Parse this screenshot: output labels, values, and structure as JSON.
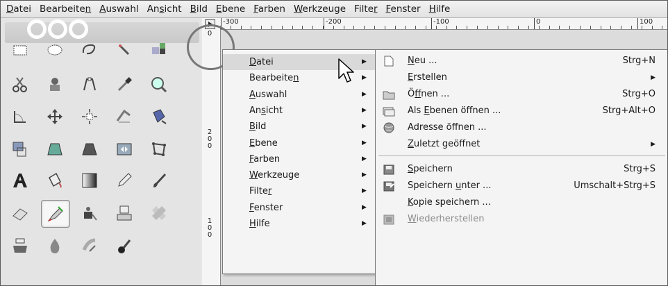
{
  "menubar": {
    "items": [
      {
        "pre": "",
        "key": "D",
        "post": "atei"
      },
      {
        "pre": "Bearbeite",
        "key": "n",
        "post": ""
      },
      {
        "pre": "",
        "key": "A",
        "post": "uswahl"
      },
      {
        "pre": "An",
        "key": "s",
        "post": "icht"
      },
      {
        "pre": "",
        "key": "B",
        "post": "ild"
      },
      {
        "pre": "",
        "key": "E",
        "post": "bene"
      },
      {
        "pre": "",
        "key": "F",
        "post": "arben"
      },
      {
        "pre": "",
        "key": "W",
        "post": "erkzeuge"
      },
      {
        "pre": "Filte",
        "key": "r",
        "post": ""
      },
      {
        "pre": "",
        "key": "F",
        "post": "enster"
      },
      {
        "pre": "",
        "key": "H",
        "post": "ilfe"
      }
    ]
  },
  "ruler": {
    "h_labels": [
      "-300",
      "-200",
      "-100",
      "0",
      "100"
    ],
    "v_labels": [
      "200",
      "100"
    ],
    "v_zero": "0"
  },
  "toolbox": {
    "tools": [
      "rect-select-icon",
      "ellipse-select-icon",
      "free-select-icon",
      "fuzzy-select-icon",
      "color-select-icon",
      "scissors-select-icon",
      "foreground-select-icon",
      "paths-icon",
      "color-picker-icon",
      "zoom-icon",
      "measure-icon",
      "move-icon",
      "align-icon",
      "crop-icon",
      "rotate-icon",
      "scale-icon",
      "shear-icon",
      "perspective-icon",
      "flip-icon",
      "cage-transform-icon",
      "text-icon",
      "bucket-fill-icon",
      "blend-icon",
      "pencil-icon",
      "paintbrush-icon",
      "eraser-icon",
      "airbrush-icon",
      "ink-icon",
      "clone-icon",
      "heal-icon",
      "perspective-clone-icon",
      "blur-icon",
      "smudge-icon",
      "dodge-burn-icon"
    ],
    "selected": "airbrush-icon"
  },
  "popup_main": {
    "items": [
      {
        "pre": "",
        "key": "D",
        "post": "atei"
      },
      {
        "pre": "Bearbeite",
        "key": "n",
        "post": ""
      },
      {
        "pre": "",
        "key": "A",
        "post": "uswahl"
      },
      {
        "pre": "An",
        "key": "s",
        "post": "icht"
      },
      {
        "pre": "",
        "key": "B",
        "post": "ild"
      },
      {
        "pre": "",
        "key": "E",
        "post": "bene"
      },
      {
        "pre": "",
        "key": "F",
        "post": "arben"
      },
      {
        "pre": "",
        "key": "W",
        "post": "erkzeuge"
      },
      {
        "pre": "Filte",
        "key": "r",
        "post": ""
      },
      {
        "pre": "",
        "key": "F",
        "post": "enster"
      },
      {
        "pre": "",
        "key": "H",
        "post": "ilfe"
      }
    ],
    "arrow": "▶"
  },
  "popup_datei": {
    "items": [
      {
        "icon": "new-file-icon",
        "pre": "",
        "key": "N",
        "post": "eu ...",
        "shortcut": "Strg+N"
      },
      {
        "icon": "",
        "pre": "",
        "key": "E",
        "post": "rstellen",
        "shortcut": "",
        "submenu": true
      },
      {
        "icon": "open-folder-icon",
        "pre": "Ö",
        "key": "f",
        "post": "fnen ...",
        "shortcut": "Strg+O"
      },
      {
        "icon": "open-as-layers-icon",
        "pre": "Als ",
        "key": "E",
        "post": "benen öffnen ...",
        "shortcut": "Strg+Alt+O"
      },
      {
        "icon": "globe-icon",
        "pre": "Adresse öffnen ...",
        "key": "",
        "post": "",
        "shortcut": ""
      },
      {
        "icon": "",
        "pre": "",
        "key": "Z",
        "post": "uletzt geöffnet",
        "shortcut": "",
        "submenu": true
      },
      {
        "icon": "save-icon",
        "pre": "",
        "key": "S",
        "post": "peichern",
        "shortcut": "Strg+S"
      },
      {
        "icon": "save-as-icon",
        "pre": "Speichern ",
        "key": "u",
        "post": "nter ...",
        "shortcut": "Umschalt+Strg+S"
      },
      {
        "icon": "",
        "pre": "",
        "key": "K",
        "post": "opie speichern ...",
        "shortcut": ""
      },
      {
        "icon": "revert-icon",
        "pre": "",
        "key": "W",
        "post": "iederherstellen",
        "shortcut": "",
        "disabled": true
      }
    ],
    "arrow": "▶"
  }
}
